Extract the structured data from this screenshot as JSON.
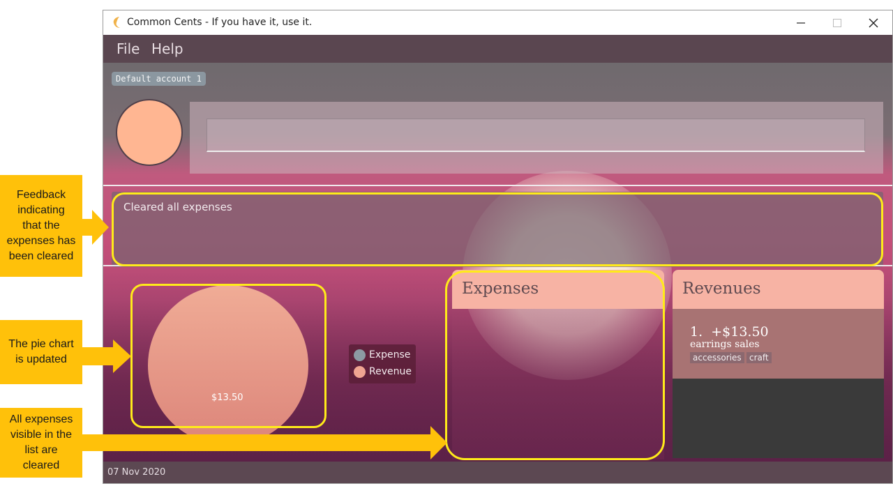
{
  "window": {
    "title": "Common Cents - If you have it, use it.",
    "controls": {
      "minimize": "—",
      "maximize": "☐",
      "close": "✕"
    }
  },
  "menu": {
    "items": [
      "File",
      "Help"
    ]
  },
  "account": {
    "name": "Default account 1"
  },
  "command": {
    "input_value": ""
  },
  "result": {
    "message": "Cleared all expenses"
  },
  "pie_chart": {
    "slice_label": "$13.50",
    "legend": [
      {
        "label": "Expense",
        "color": "#8c9aa3"
      },
      {
        "label": "Revenue",
        "color": "#efa592"
      }
    ]
  },
  "expenses": {
    "title": "Expenses",
    "items": []
  },
  "revenues": {
    "title": "Revenues",
    "items": [
      {
        "index": "1.",
        "amount": "+$13.50",
        "description": "earrings sales",
        "tags": [
          "accessories",
          "craft"
        ]
      }
    ]
  },
  "status": {
    "date": "07 Nov 2020"
  },
  "annotations": {
    "feedback": "Feedback\nindicating\nthat the\nexpenses has\nbeen cleared",
    "pie": "The pie chart\nis updated",
    "list": "All expenses\nvisible in the\nlist are\ncleared"
  },
  "colors": {
    "accent": "#f7b3a4",
    "highlight": "#ffeb1a",
    "callout": "#ffc10a"
  }
}
